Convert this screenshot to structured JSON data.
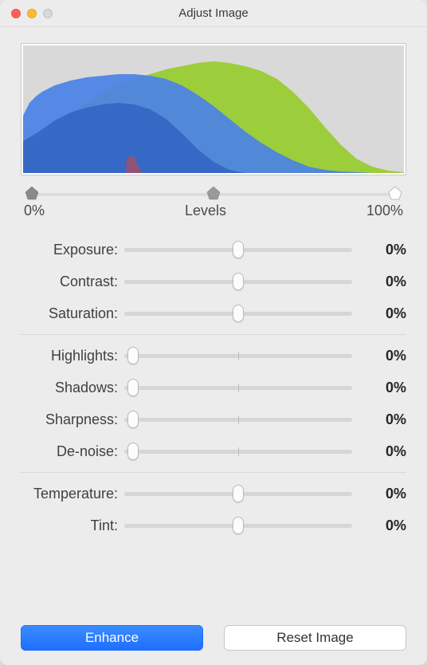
{
  "window": {
    "title": "Adjust Image"
  },
  "levels": {
    "left_label": "0%",
    "center_label": "Levels",
    "right_label": "100%"
  },
  "sliders": {
    "exposure": {
      "label": "Exposure:",
      "value": "0%",
      "pos": 50,
      "tick": 50
    },
    "contrast": {
      "label": "Contrast:",
      "value": "0%",
      "pos": 50,
      "tick": 50
    },
    "saturation": {
      "label": "Saturation:",
      "value": "0%",
      "pos": 50,
      "tick": 50
    },
    "highlights": {
      "label": "Highlights:",
      "value": "0%",
      "pos": 4,
      "tick": 50
    },
    "shadows": {
      "label": "Shadows:",
      "value": "0%",
      "pos": 4,
      "tick": 50
    },
    "sharpness": {
      "label": "Sharpness:",
      "value": "0%",
      "pos": 4,
      "tick": 50
    },
    "denoise": {
      "label": "De-noise:",
      "value": "0%",
      "pos": 4,
      "tick": 50
    },
    "temperature": {
      "label": "Temperature:",
      "value": "0%",
      "pos": 50,
      "tick": 50
    },
    "tint": {
      "label": "Tint:",
      "value": "0%",
      "pos": 50,
      "tick": 50
    }
  },
  "buttons": {
    "enhance": "Enhance",
    "reset": "Reset Image"
  }
}
